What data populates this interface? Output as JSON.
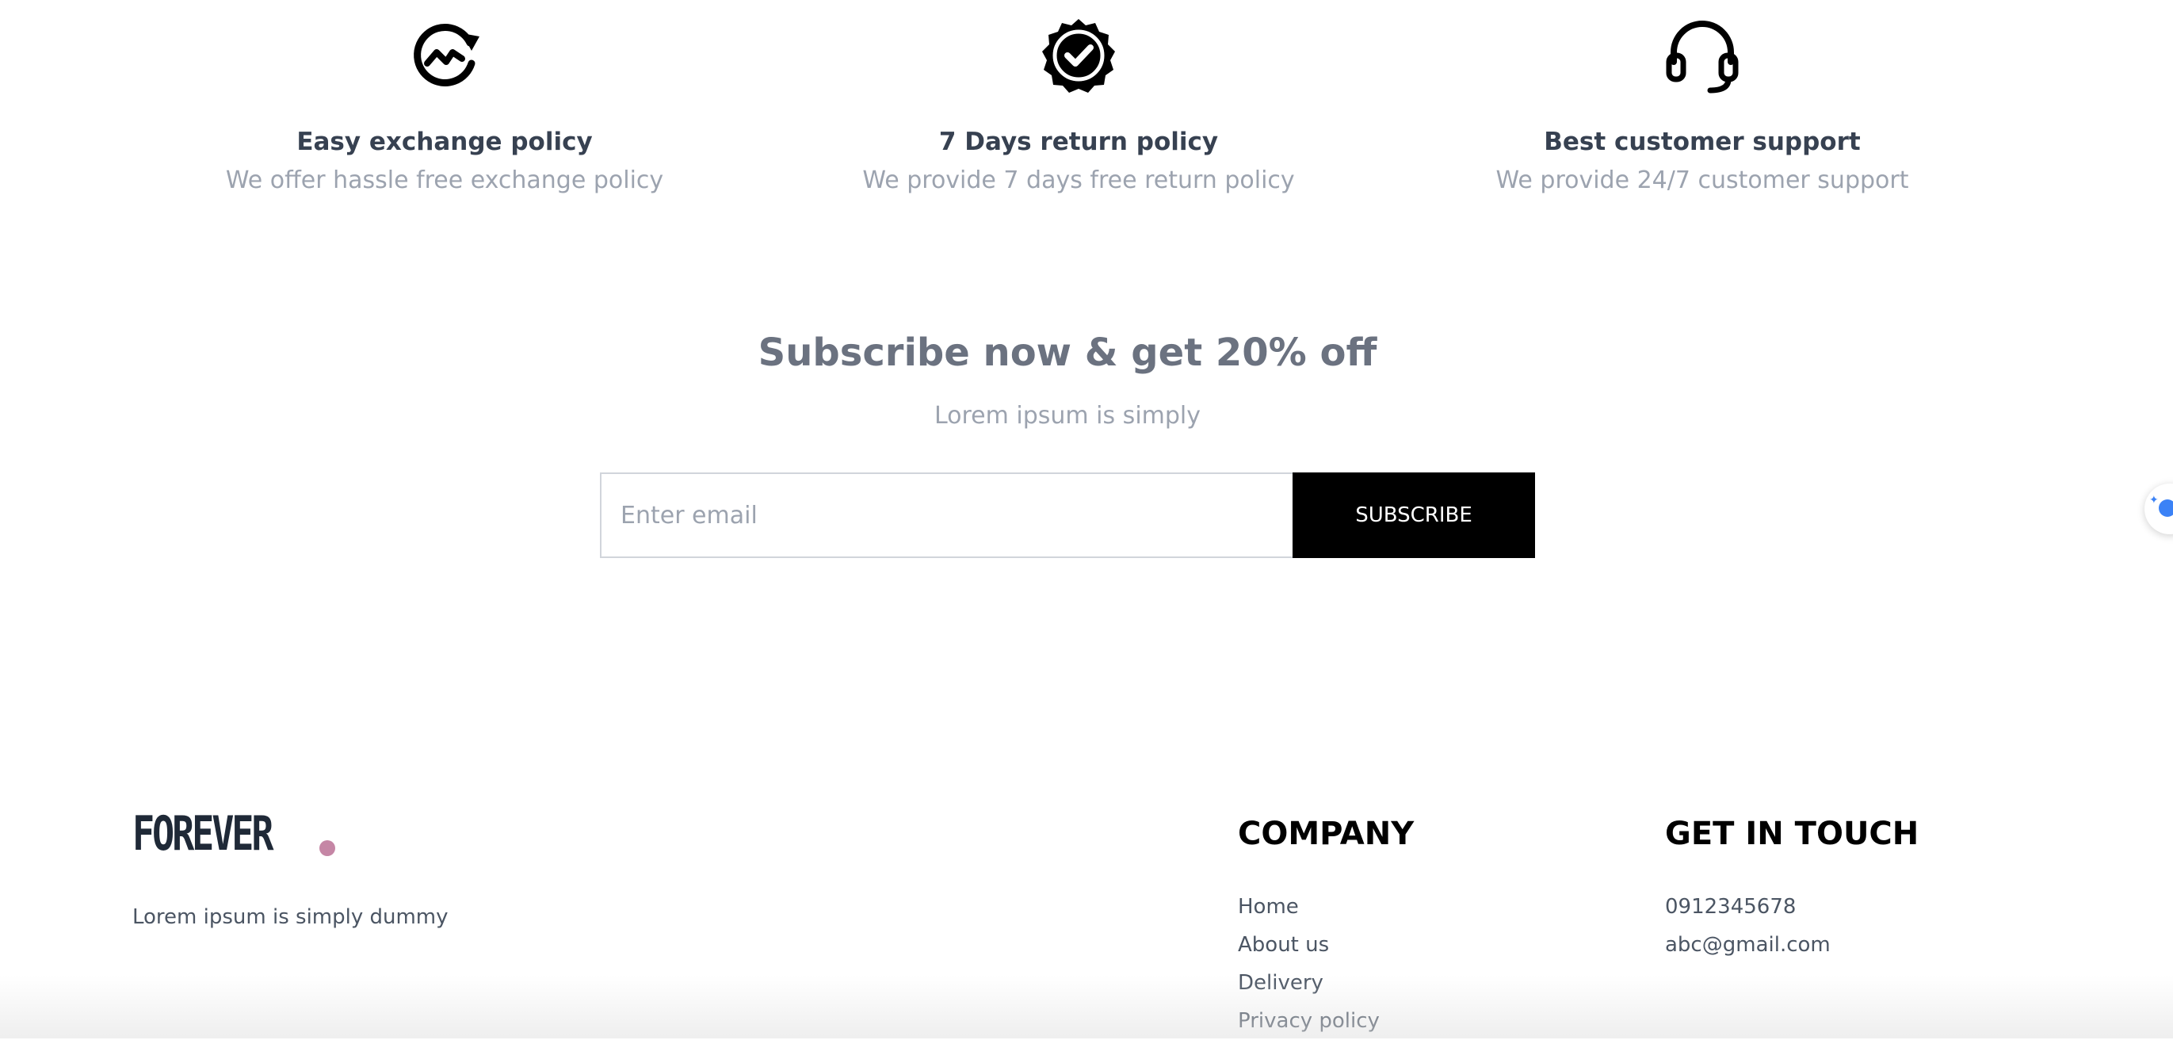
{
  "policies": [
    {
      "icon": "exchange-icon",
      "title": "Easy exchange policy",
      "description": "We offer hassle free exchange policy"
    },
    {
      "icon": "verified-badge-icon",
      "title": "7 Days return policy",
      "description": "We provide 7 days free return policy"
    },
    {
      "icon": "headset-icon",
      "title": "Best customer support",
      "description": "We provide 24/7 customer support"
    }
  ],
  "subscribe": {
    "title": "Subscribe now & get 20% off",
    "text": "Lorem ipsum is simply",
    "email_placeholder": "Enter email",
    "button_label": "SUBSCRIBE"
  },
  "footer": {
    "logo_text": "FOREVER",
    "logo_dot_color": "#c586a5",
    "description": "Lorem ipsum is simply dummy",
    "company": {
      "heading": "COMPANY",
      "links": [
        "Home",
        "About us",
        "Delivery",
        "Privacy policy"
      ]
    },
    "contact": {
      "heading": "GET IN TOUCH",
      "items": [
        "0912345678",
        "abc@gmail.com"
      ]
    }
  },
  "colors": {
    "heading": "#374151",
    "muted": "#9ca3af",
    "button_bg": "#000000",
    "widget_accent": "#3b82f6"
  }
}
